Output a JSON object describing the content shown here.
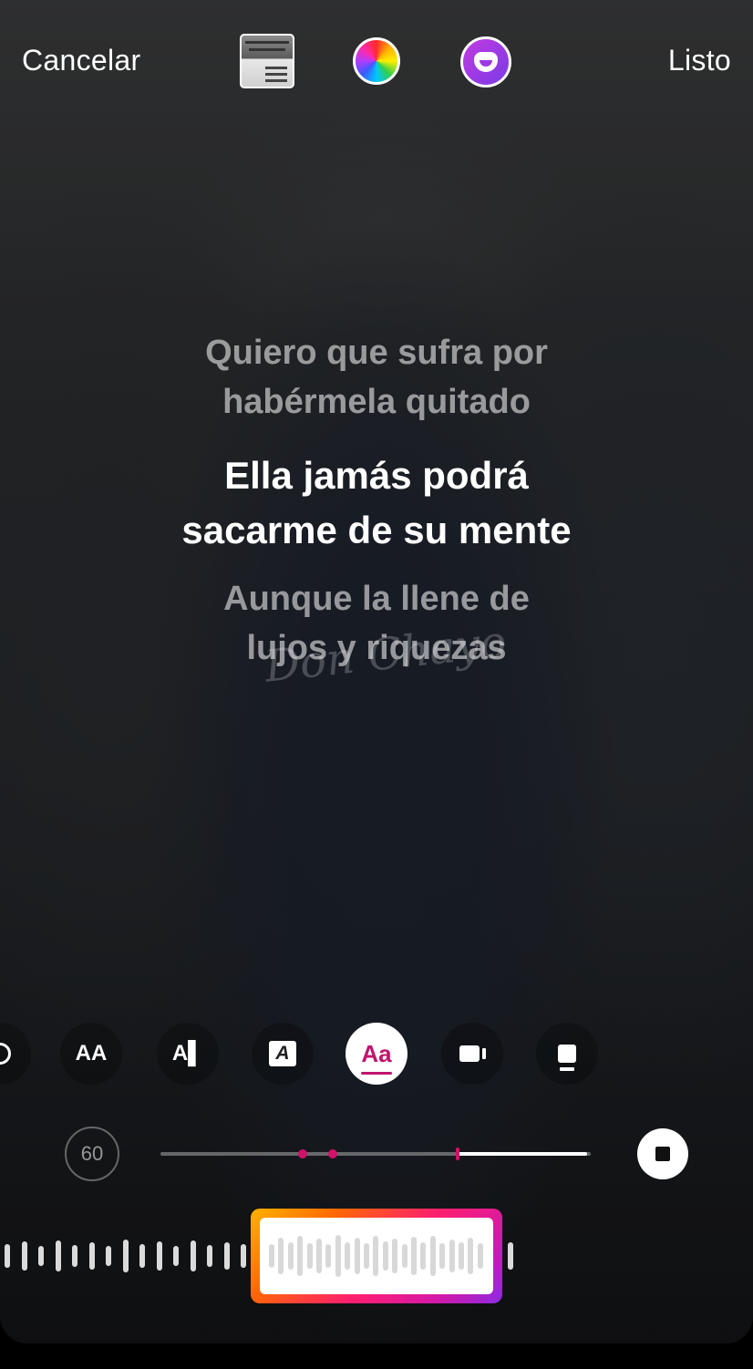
{
  "header": {
    "cancel_label": "Cancelar",
    "done_label": "Listo",
    "album_cover_icon": "album-cover",
    "color_picker_icon": "color-wheel",
    "effect_icon": "face-effect"
  },
  "lyrics": {
    "previous_line_1": "Quiero que sufra por",
    "previous_line_2": "habérmela quitado",
    "current_line_1": "Ella jamás podrá",
    "current_line_2": "sacarme de su mente",
    "next_line_1": "Aunque la llene de",
    "next_line_2": "lujos y riquezas"
  },
  "watermark": "Don Chayo",
  "style_buttons": [
    {
      "name": "close-icon"
    },
    {
      "glyph": "AA",
      "name": "text-size-icon"
    },
    {
      "glyph": "A▌",
      "name": "text-highlight-icon"
    },
    {
      "glyph": "A",
      "name": "text-box-icon"
    },
    {
      "glyph": "Aa",
      "name": "font-style-icon",
      "active": true
    },
    {
      "name": "video-icon"
    },
    {
      "name": "phone-icon"
    }
  ],
  "playback": {
    "duration_label": "60",
    "progress_fraction": 0.31,
    "markers": [
      0.33,
      0.4
    ]
  },
  "colors": {
    "accent": "#c1146e",
    "marker": "#d01268",
    "wave_frame_start": "#ffb300",
    "wave_frame_end": "#8a2be2"
  }
}
